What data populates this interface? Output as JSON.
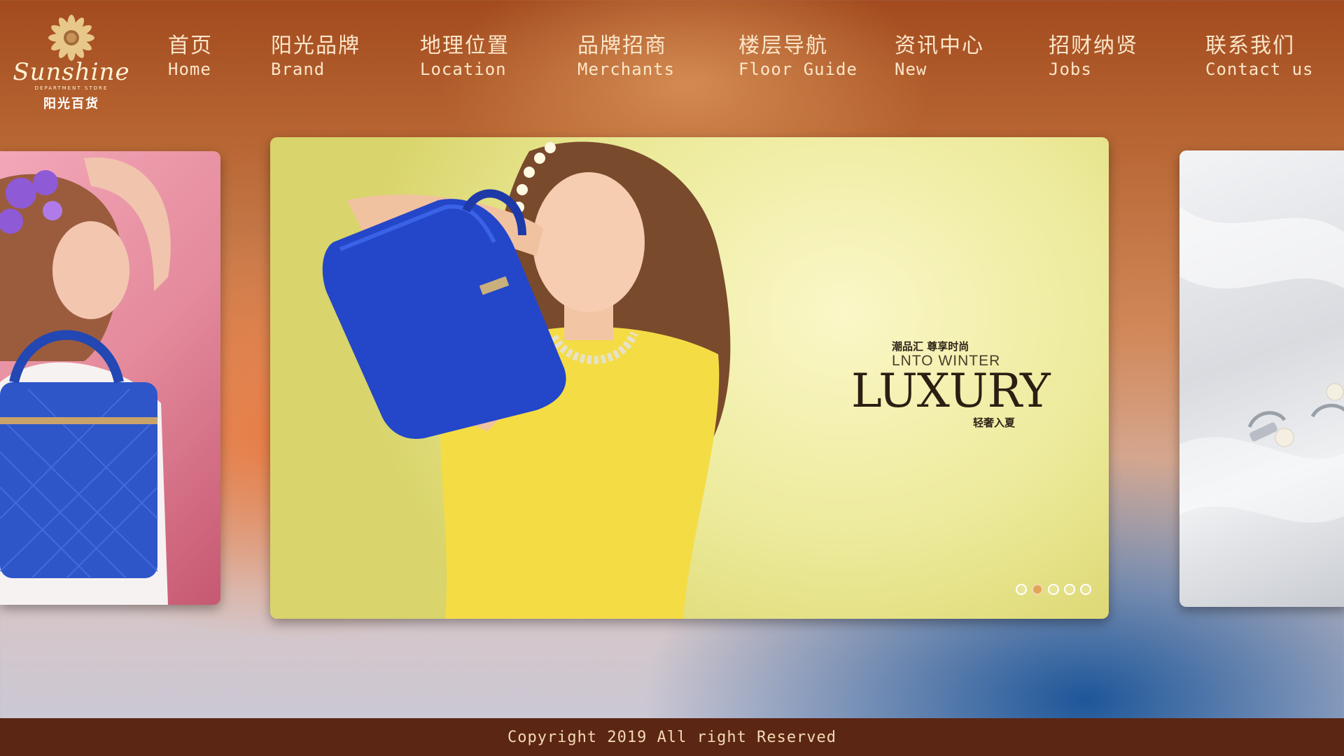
{
  "logo": {
    "script": "Sunshine",
    "subtitle": "DEPARTMENT STORE",
    "chinese": "阳光百货"
  },
  "nav": [
    {
      "cn": "首页",
      "en": "Home"
    },
    {
      "cn": "阳光品牌",
      "en": "Brand"
    },
    {
      "cn": "地理位置",
      "en": "Location"
    },
    {
      "cn": "品牌招商",
      "en": "Merchants"
    },
    {
      "cn": "楼层导航",
      "en": "Floor Guide"
    },
    {
      "cn": "资讯中心",
      "en": "New"
    },
    {
      "cn": "招财纳贤",
      "en": "Jobs"
    },
    {
      "cn": "联系我们",
      "en": "Contact us"
    }
  ],
  "banner": {
    "top_cn": "潮品汇 尊享时尚",
    "winter": "LNTO WINTER",
    "luxury": "LUXURY",
    "bottom_cn": "轻奢入夏",
    "dots_count": 5,
    "active_dot": 1
  },
  "colors": {
    "footer_bg": "#5c2614",
    "nav_text": "#fbe6c9",
    "dot_active": "#e0a55a"
  },
  "footer": {
    "copyright": "Copyright 2019 All right Reserved"
  }
}
